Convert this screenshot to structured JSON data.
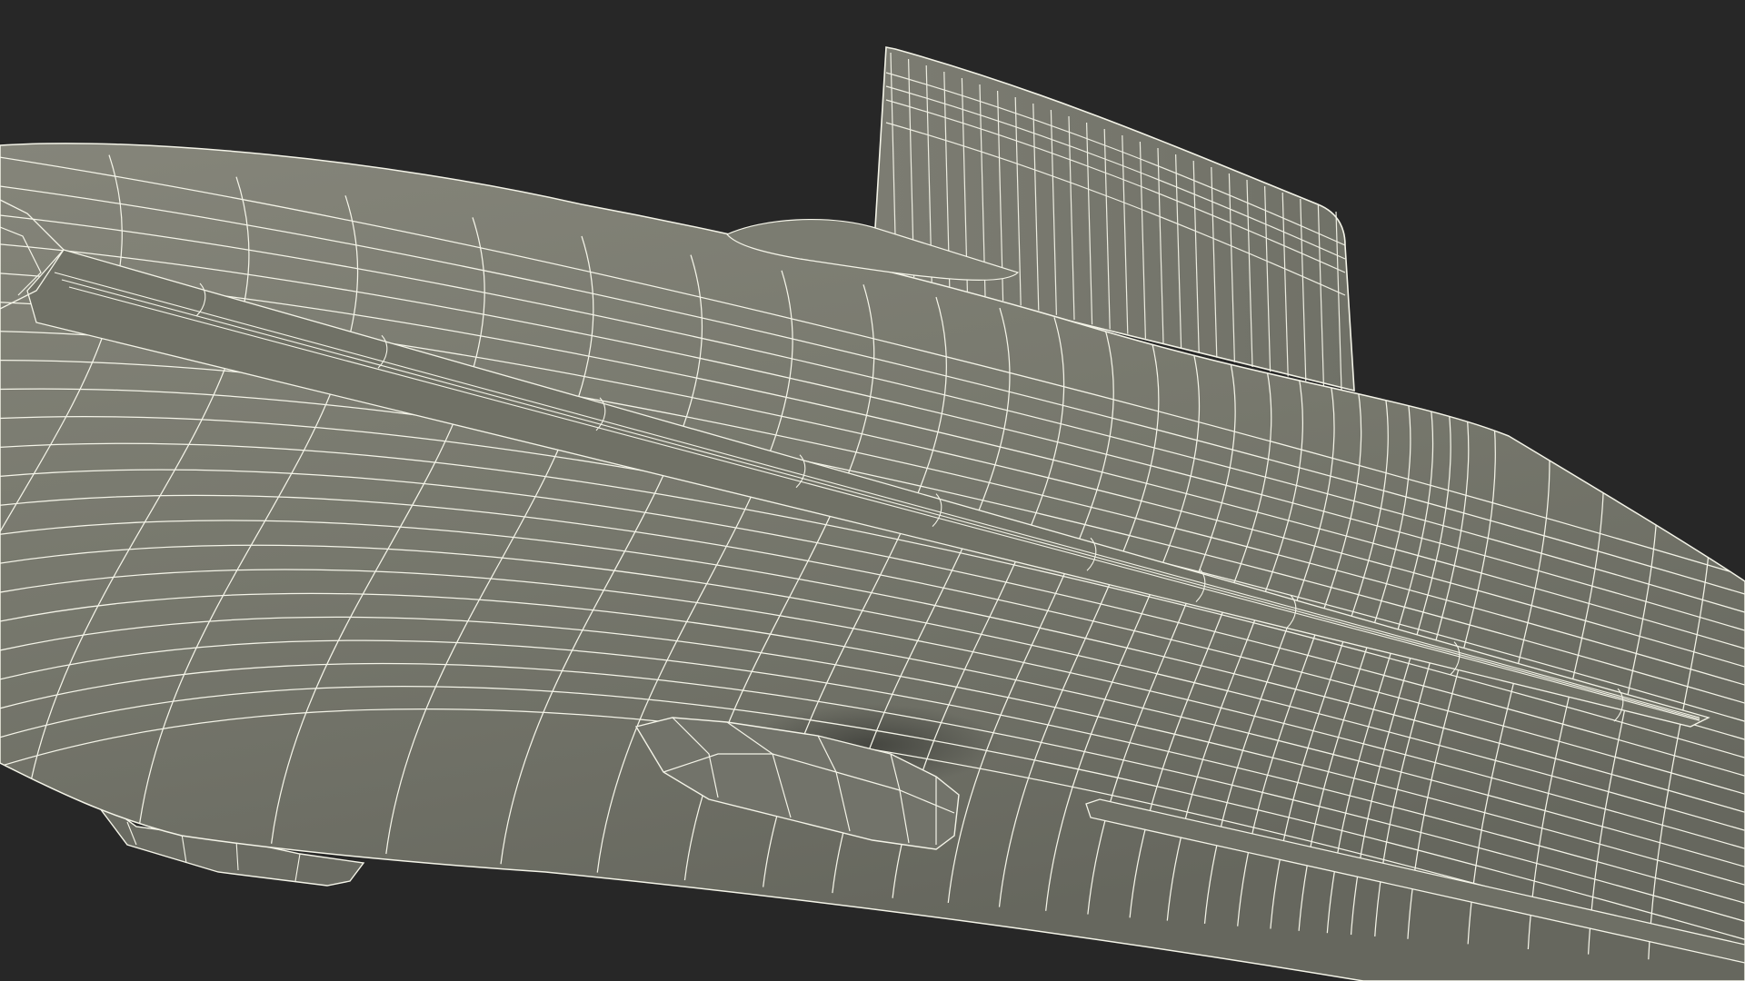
{
  "scene": {
    "subject": "submarine-wireframe-render",
    "colors": {
      "background": "#272727",
      "hull_light": "#838378",
      "hull_mid": "#76776c",
      "hull_dark": "#66675e",
      "shadow": "#4f504a",
      "wire": "#f4f4e8"
    }
  }
}
